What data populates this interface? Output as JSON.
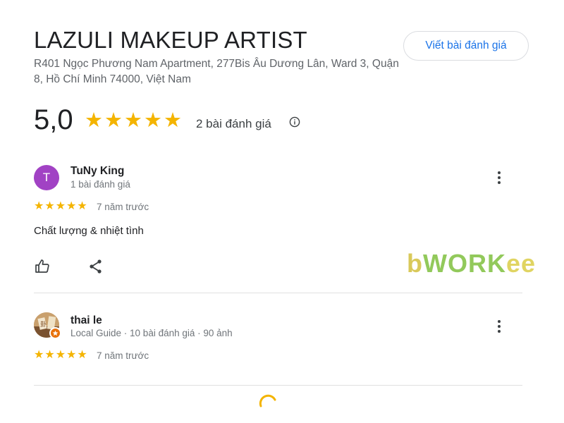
{
  "business": {
    "name": "LAZULI MAKEUP ARTIST",
    "address": "R401 Ngọc Phương Nam Apartment, 277Bis Âu Dương Lân, Ward 3, Quận 8, Hồ Chí Minh 74000, Việt Nam",
    "write_review_label": "Viết bài đánh giá"
  },
  "summary": {
    "rating": "5,0",
    "stars": 5,
    "count_label": "2 bài đánh giá",
    "info_icon": "info-icon"
  },
  "reviews": [
    {
      "avatar_letter": "T",
      "avatar_color": "#a142c4",
      "name": "TuNy King",
      "meta": "1 bài đánh giá",
      "stars": 5,
      "date": "7 năm trước",
      "text": "Chất lượng & nhiệt tình",
      "actions": [
        "thumbs-up-icon",
        "share-icon"
      ]
    },
    {
      "avatar_letter": "",
      "name": "thai le",
      "meta": "Local Guide · 10 bài đánh giá · 90 ảnh",
      "stars": 5,
      "date": "7 năm trước",
      "local_guide_badge": true
    }
  ],
  "watermark": {
    "b": "b",
    "work": "WORK",
    "ee": "ee"
  },
  "colors": {
    "star": "#f4b400",
    "link": "#1a73e8",
    "spinner": "#f4b400"
  }
}
